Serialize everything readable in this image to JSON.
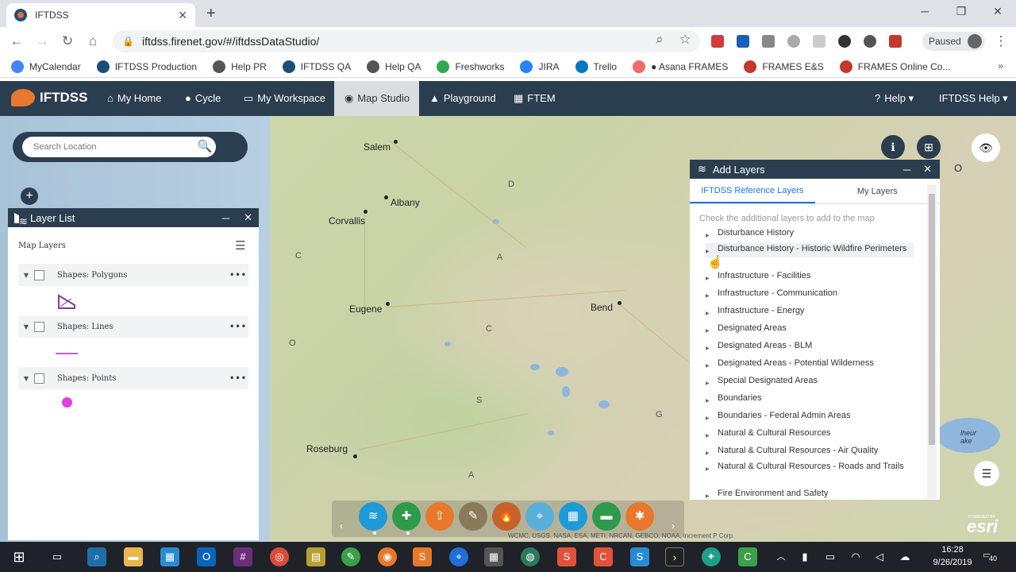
{
  "browser": {
    "tab_title": "IFTDSS",
    "url": "iftdss.firenet.gov/#/iftdssDataStudio/",
    "profile_status": "Paused"
  },
  "bookmarks": [
    {
      "label": "MyCalendar",
      "color": "#4285f4"
    },
    {
      "label": "IFTDSS Production",
      "color": "#1a4f7a"
    },
    {
      "label": "Help PR",
      "color": "#555555"
    },
    {
      "label": "IFTDSS QA",
      "color": "#1a4f7a"
    },
    {
      "label": "Help QA",
      "color": "#555555"
    },
    {
      "label": "Freshworks",
      "color": "#34a853"
    },
    {
      "label": "JIRA",
      "color": "#2684ff"
    },
    {
      "label": "Trello",
      "color": "#0079bf"
    },
    {
      "label": "● Asana FRAMES",
      "color": "#f06a6a"
    },
    {
      "label": "FRAMES E&S",
      "color": "#c0392b"
    },
    {
      "label": "FRAMES Online Co...",
      "color": "#c0392b"
    }
  ],
  "app": {
    "brand": "IFTDSS",
    "nav": [
      {
        "label": "My Home",
        "glyph": "⌂"
      },
      {
        "label": "Cycle",
        "glyph": "●"
      },
      {
        "label": "My Workspace",
        "glyph": "▭"
      },
      {
        "label": "Map Studio",
        "glyph": "◉"
      },
      {
        "label": "Playground",
        "glyph": "▲"
      },
      {
        "label": "FTEM",
        "glyph": "▦"
      }
    ],
    "help": "Help ▾",
    "help_glyph": "?",
    "iftdss_help": "IFTDSS Help ▾"
  },
  "search": {
    "placeholder": "Search Location",
    "button": "🔍"
  },
  "layer_list": {
    "title": "Layer List",
    "section": "Map Layers",
    "layers": [
      {
        "name": "Shapes: Polygons",
        "symbol": "polygon"
      },
      {
        "name": "Shapes: Lines",
        "symbol": "line"
      },
      {
        "name": "Shapes: Points",
        "symbol": "point"
      }
    ],
    "accent": "#7b3fa0",
    "point_color": "#e040e0"
  },
  "map": {
    "cities": [
      {
        "name": "Salem"
      },
      {
        "name": "Albany"
      },
      {
        "name": "Corvallis"
      },
      {
        "name": "Eugene"
      },
      {
        "name": "Bend"
      },
      {
        "name": "Roseburg"
      }
    ],
    "attribution": "WCMC, USGS, NASA, ESA, METI, NRCAN, GEBCO, NOAA, increment P Corp.",
    "esri": "esri",
    "esri_powered": "POWERED BY",
    "lake_label": "lheur ake"
  },
  "add_layers": {
    "title": "Add Layers",
    "tabs": [
      "IFTDSS Reference Layers",
      "My Layers"
    ],
    "help_text": "Check the additional layers to add to the map",
    "items": [
      "Disturbance History",
      "Disturbance History - Historic Wildfire Perimeters",
      "Infrastructure - Facilities",
      "Infrastructure - Communication",
      "Infrastructure - Energy",
      "Designated Areas",
      "Designated Areas - BLM",
      "Designated Areas - Potential Wilderness",
      "Special Designated Areas",
      "Boundaries",
      "Boundaries - Federal Admin Areas",
      "Natural & Cultural Resources",
      "Natural & Cultural Resources - Air Quality",
      "Natural & Cultural Resources - Roads and Trails",
      "Fire Environment and Safety"
    ]
  },
  "tools": [
    {
      "name": "layers",
      "color": "#1e9bd7",
      "glyph": "≋"
    },
    {
      "name": "add-layers",
      "color": "#2e9a4b",
      "glyph": "✚"
    },
    {
      "name": "upload",
      "color": "#e8782c",
      "glyph": "⇧"
    },
    {
      "name": "edit-shapes",
      "color": "#8a7a5a",
      "glyph": "✎"
    },
    {
      "name": "fire",
      "color": "#c8622c",
      "glyph": "🔥"
    },
    {
      "name": "location",
      "color": "#5ab0d8",
      "glyph": "⌖"
    },
    {
      "name": "grid",
      "color": "#1e9bd7",
      "glyph": "▦"
    },
    {
      "name": "measure",
      "color": "#2e9a4b",
      "glyph": "▬"
    },
    {
      "name": "landfire",
      "color": "#e8782c",
      "glyph": "✱"
    }
  ],
  "taskbar": {
    "time": "16:28",
    "date": "9/26/2019",
    "notifications": "40"
  }
}
